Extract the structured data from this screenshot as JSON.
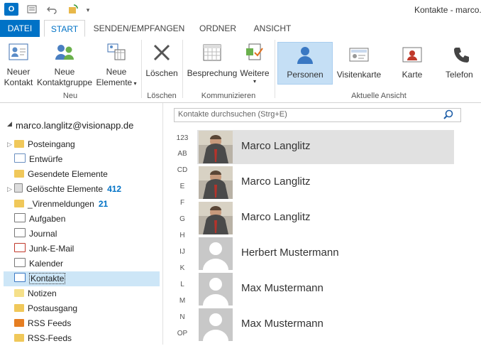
{
  "window": {
    "title": "Kontakte - marco."
  },
  "tabs": [
    "DATEI",
    "START",
    "SENDEN/EMPFANGEN",
    "ORDNER",
    "ANSICHT"
  ],
  "ribbon": {
    "new_contact": "Neuer\nKontakt",
    "new_contact_l1": "Neuer",
    "new_contact_l2": "Kontakt",
    "new_group_l1": "Neue",
    "new_group_l2": "Kontaktgruppe",
    "new_items_l1": "Neue",
    "new_items_l2": "Elemente",
    "delete": "Löschen",
    "meeting": "Besprechung",
    "more": "Weitere",
    "view_people": "Personen",
    "view_card": "Visitenkarte",
    "view_karte": "Karte",
    "view_phone": "Telefon",
    "groups": {
      "neu": "Neu",
      "loeschen": "Löschen",
      "kommunizieren": "Kommunizieren",
      "ansicht": "Aktuelle Ansicht"
    }
  },
  "sidebar": {
    "account": "marco.langlitz@visionapp.de",
    "folders": [
      {
        "label": "Posteingang",
        "count": ""
      },
      {
        "label": "Entwürfe",
        "count": ""
      },
      {
        "label": "Gesendete Elemente",
        "count": ""
      },
      {
        "label": "Gelöschte Elemente",
        "count": "412"
      },
      {
        "label": "_Virenmeldungen",
        "count": "21"
      },
      {
        "label": "Aufgaben",
        "count": ""
      },
      {
        "label": "Journal",
        "count": ""
      },
      {
        "label": "Junk-E-Mail",
        "count": ""
      },
      {
        "label": "Kalender",
        "count": ""
      },
      {
        "label": "Kontakte",
        "count": ""
      },
      {
        "label": "Notizen",
        "count": ""
      },
      {
        "label": "Postausgang",
        "count": ""
      },
      {
        "label": "RSS Feeds",
        "count": ""
      },
      {
        "label": "RSS-Feeds",
        "count": ""
      }
    ]
  },
  "search": {
    "placeholder": "Kontakte durchsuchen (Strg+E)"
  },
  "index_letters": [
    "123",
    "AB",
    "CD",
    "E",
    "F",
    "G",
    "H",
    "IJ",
    "K",
    "L",
    "M",
    "N",
    "OP"
  ],
  "contacts": [
    {
      "name": "Marco Langlitz",
      "photo": "portrait"
    },
    {
      "name": "Marco Langlitz",
      "photo": "portrait"
    },
    {
      "name": "Marco Langlitz",
      "photo": "portrait"
    },
    {
      "name": "Herbert Mustermann",
      "photo": "placeholder"
    },
    {
      "name": "Max Mustermann",
      "photo": "placeholder"
    },
    {
      "name": "Max Mustermann",
      "photo": "placeholder"
    }
  ],
  "colors": {
    "accent": "#0072c6",
    "selection": "#cde6f7",
    "card_selected": "#e1e1e1",
    "count": "#0072c6"
  }
}
